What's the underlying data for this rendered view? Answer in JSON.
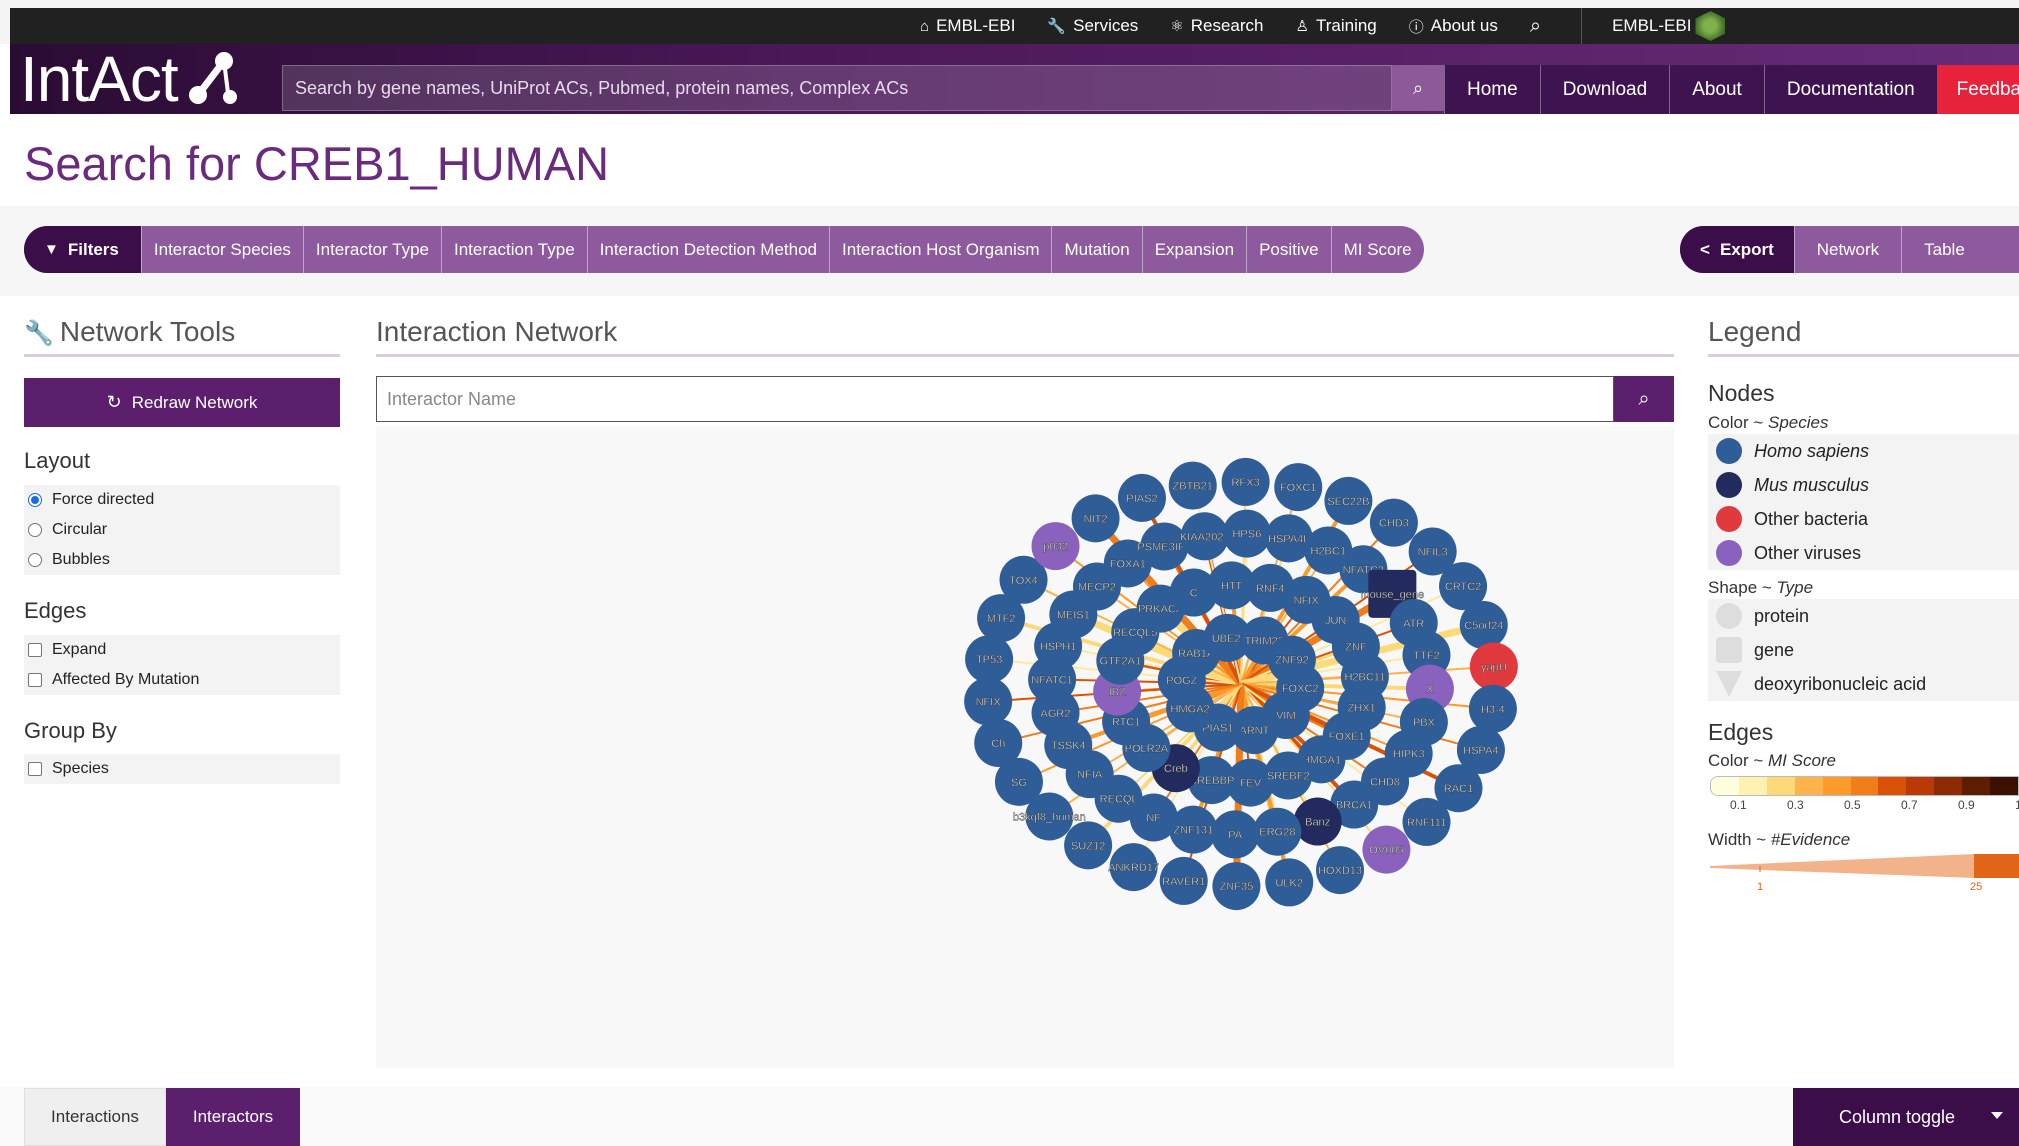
{
  "top_nav": {
    "links": [
      {
        "icon": "home-icon",
        "glyph": "⌂",
        "label": "EMBL-EBI"
      },
      {
        "icon": "wrench-icon",
        "glyph": "🔧",
        "label": "Services"
      },
      {
        "icon": "molecule-icon",
        "glyph": "⚛",
        "label": "Research"
      },
      {
        "icon": "person-icon",
        "glyph": "♙",
        "label": "Training"
      },
      {
        "icon": "info-icon",
        "glyph": "ⓘ",
        "label": "About us"
      }
    ],
    "search_glyph": "⌕",
    "brand": "EMBL-EBI"
  },
  "masthead": {
    "logo_text": "IntAct",
    "search_placeholder": "Search by gene names, UniProt ACs, Pubmed, protein names, Complex ACs",
    "search_glyph": "⌕",
    "nav": [
      "Home",
      "Download",
      "About",
      "Documentation"
    ],
    "feedback": "Feedback"
  },
  "page": {
    "title": "Search for CREB1_HUMAN"
  },
  "filters": {
    "label": "Filters",
    "items": [
      "Interactor Species",
      "Interactor Type",
      "Interaction Type",
      "Interaction Detection Method",
      "Interaction Host Organism",
      "Mutation",
      "Expansion",
      "Positive",
      "MI Score"
    ]
  },
  "export": {
    "label": "Export",
    "items": [
      "Network",
      "Table"
    ]
  },
  "tools": {
    "title": "Network Tools",
    "redraw": "Redraw Network",
    "layout_title": "Layout",
    "layouts": [
      {
        "label": "Force directed",
        "selected": true
      },
      {
        "label": "Circular",
        "selected": false
      },
      {
        "label": "Bubbles",
        "selected": false
      }
    ],
    "edges_title": "Edges",
    "edges": [
      "Expand",
      "Affected By Mutation"
    ],
    "group_title": "Group By",
    "group": [
      "Species"
    ]
  },
  "network": {
    "title": "Interaction Network",
    "search_placeholder": "Interactor Name",
    "colors": {
      "human": "#2f5d97",
      "mouse": "#232a5e",
      "virus": "#8a62be",
      "bacteria": "#e03a3e"
    },
    "nodes": [
      {
        "label": "VIM",
        "s": "human"
      },
      {
        "label": "ARNT",
        "s": "human"
      },
      {
        "label": "PIAS1",
        "s": "human"
      },
      {
        "label": "HMGA2",
        "s": "human"
      },
      {
        "label": "POGZ",
        "s": "human"
      },
      {
        "label": "RAB1A",
        "s": "human"
      },
      {
        "label": "UBE2I",
        "s": "human"
      },
      {
        "label": "TRIM22",
        "s": "human"
      },
      {
        "label": "ZNF92",
        "s": "human"
      },
      {
        "label": "FOXC2",
        "s": "human"
      },
      {
        "label": "FEV",
        "s": "human"
      },
      {
        "label": "CREBBP",
        "s": "human"
      },
      {
        "label": "Creb",
        "s": "mouse"
      },
      {
        "label": "POLR2A",
        "s": "human"
      },
      {
        "label": "RTC1",
        "s": "human"
      },
      {
        "label": "IBZ",
        "s": "virus"
      },
      {
        "label": "GTF2A1",
        "s": "human"
      },
      {
        "label": "RECQL5",
        "s": "human"
      },
      {
        "label": "PRKACA",
        "s": "human"
      },
      {
        "label": "C",
        "s": "human"
      },
      {
        "label": "HTT",
        "s": "human"
      },
      {
        "label": "RNF4",
        "s": "human"
      },
      {
        "label": "NFIX",
        "s": "human"
      },
      {
        "label": "JUN",
        "s": "human"
      },
      {
        "label": "ZNF",
        "s": "human"
      },
      {
        "label": "H2BC11",
        "s": "human"
      },
      {
        "label": "ZHX1",
        "s": "human"
      },
      {
        "label": "FOXE1",
        "s": "human"
      },
      {
        "label": "HMGA1",
        "s": "human"
      },
      {
        "label": "SREBF2",
        "s": "human"
      },
      {
        "label": "RECQL",
        "s": "human"
      },
      {
        "label": "NFIA",
        "s": "human"
      },
      {
        "label": "TSSK4",
        "s": "human"
      },
      {
        "label": "AGR2",
        "s": "human"
      },
      {
        "label": "NFATC1",
        "s": "human"
      },
      {
        "label": "HSPH1",
        "s": "human"
      },
      {
        "label": "MEIS1",
        "s": "human"
      },
      {
        "label": "MECP2",
        "s": "human"
      },
      {
        "label": "FOXA1",
        "s": "human"
      },
      {
        "label": "PSME3IP1",
        "s": "human"
      },
      {
        "label": "KIAA2026",
        "s": "human"
      },
      {
        "label": "HPS6",
        "s": "human"
      },
      {
        "label": "HSPA4L",
        "s": "human"
      },
      {
        "label": "H2BC1",
        "s": "human"
      },
      {
        "label": "NFATC2",
        "s": "human"
      },
      {
        "label": "mouse_gene",
        "s": "mouse"
      },
      {
        "label": "ATR",
        "s": "human"
      },
      {
        "label": "TTF2",
        "s": "human"
      },
      {
        "label": "X",
        "s": "virus"
      },
      {
        "label": "PBX",
        "s": "human"
      },
      {
        "label": "HIPK3",
        "s": "human"
      },
      {
        "label": "CHD8",
        "s": "human"
      },
      {
        "label": "BRCA1",
        "s": "human"
      },
      {
        "label": "Banz",
        "s": "mouse"
      },
      {
        "label": "ERG28",
        "s": "human"
      },
      {
        "label": "PA",
        "s": "human"
      },
      {
        "label": "ZNF131",
        "s": "human"
      },
      {
        "label": "NF",
        "s": "human"
      },
      {
        "label": "NFIX",
        "s": "human"
      },
      {
        "label": "TP53",
        "s": "human"
      },
      {
        "label": "MTF2",
        "s": "human"
      },
      {
        "label": "TOX4",
        "s": "human"
      },
      {
        "label": "p032",
        "s": "virus"
      },
      {
        "label": "NIT2",
        "s": "human"
      },
      {
        "label": "PIAS2",
        "s": "human"
      },
      {
        "label": "ZBTB21",
        "s": "human"
      },
      {
        "label": "RFX3",
        "s": "human"
      },
      {
        "label": "FOXC1",
        "s": "human"
      },
      {
        "label": "SEC22B",
        "s": "human"
      },
      {
        "label": "CHD3",
        "s": "human"
      },
      {
        "label": "NFIL3",
        "s": "human"
      },
      {
        "label": "CRTC2",
        "s": "human"
      },
      {
        "label": "C5orf24",
        "s": "human"
      },
      {
        "label": "yapH",
        "s": "bacteria"
      },
      {
        "label": "H3-4",
        "s": "human"
      },
      {
        "label": "HSPA4",
        "s": "human"
      },
      {
        "label": "RAC1",
        "s": "human"
      },
      {
        "label": "RNF111",
        "s": "human"
      },
      {
        "label": "OV005",
        "s": "virus"
      },
      {
        "label": "HOXD13",
        "s": "human"
      },
      {
        "label": "ULK2",
        "s": "human"
      },
      {
        "label": "ZNF35",
        "s": "human"
      },
      {
        "label": "RAVER1",
        "s": "human"
      },
      {
        "label": "ANKRD17",
        "s": "human"
      },
      {
        "label": "SUZ12",
        "s": "human"
      },
      {
        "label": "b3kqf8_human",
        "s": "human"
      },
      {
        "label": "SG",
        "s": "human"
      },
      {
        "label": "Ch",
        "s": "human"
      }
    ]
  },
  "legend": {
    "title": "Legend",
    "nodes_title": "Nodes",
    "color_caption_prefix": "Color ~ ",
    "color_caption_var": "Species",
    "species": [
      {
        "label": "Homo sapiens",
        "color": "#2f5d97",
        "italic": true
      },
      {
        "label": "Mus musculus",
        "color": "#232a5e",
        "italic": true
      },
      {
        "label": "Other bacteria",
        "color": "#e03a3e",
        "italic": false
      },
      {
        "label": "Other viruses",
        "color": "#8a62be",
        "italic": false
      }
    ],
    "shape_caption_prefix": "Shape ~ ",
    "shape_caption_var": "Type",
    "types": [
      "protein",
      "gene",
      "deoxyribonucleic acid"
    ],
    "edges_title": "Edges",
    "edge_color_caption_prefix": "Color ~ ",
    "edge_color_caption_var": "MI Score",
    "scale_colors": [
      "#ffffe0",
      "#fff1b0",
      "#fed978",
      "#feb24c",
      "#fd9a2a",
      "#f07c1a",
      "#d95208",
      "#b83a06",
      "#8c2a04",
      "#5e1d02",
      "#3b1000"
    ],
    "scale_labels": [
      "0.1",
      "0.3",
      "0.5",
      "0.7",
      "0.9",
      "1"
    ],
    "width_caption_prefix": "Width ~ ",
    "width_caption_var": "#Evidence",
    "width_labels": [
      "1",
      "25"
    ]
  },
  "bottom_tabs": {
    "tab1": "Interactions",
    "tab2": "Interactors",
    "column_toggle": "Column toggle"
  }
}
